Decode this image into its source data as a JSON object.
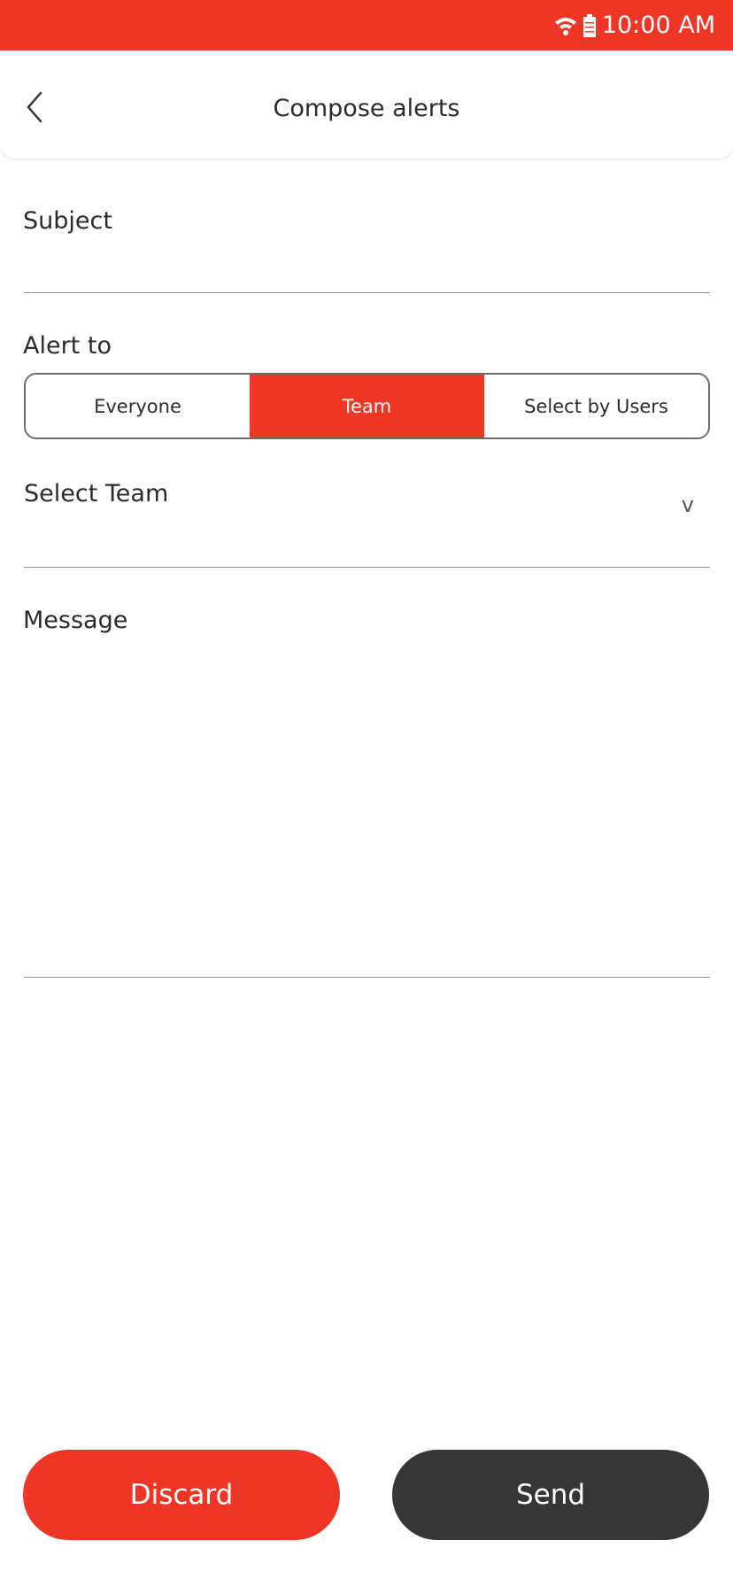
{
  "status_bar": {
    "time": "10:00 AM",
    "wifi_icon": "wifi-icon",
    "battery_icon": "battery-icon",
    "color": "#ee3526"
  },
  "header": {
    "title": "Compose alerts",
    "back_icon": "chevron-left-icon"
  },
  "form": {
    "subject": {
      "label": "Subject",
      "value": ""
    },
    "alert_to": {
      "label": "Alert to",
      "options": [
        "Everyone",
        "Team",
        "Select by Users"
      ],
      "selected": "Team"
    },
    "team_select": {
      "label": "Select Team",
      "chevron": "v"
    },
    "message": {
      "label": "Message",
      "value": ""
    }
  },
  "actions": {
    "discard_label": "Discard",
    "send_label": "Send"
  },
  "colors": {
    "accent": "#ee3526",
    "dark": "#363636",
    "text": "#2b2b2b"
  }
}
